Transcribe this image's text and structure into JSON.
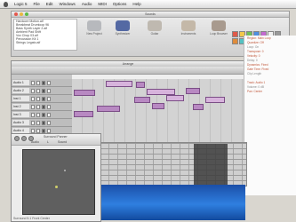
{
  "menubar": {
    "items": [
      "Apple",
      "Logic 5",
      "File",
      "Edit",
      "Windows",
      "Audio",
      "MIDI",
      "Options",
      "Help"
    ]
  },
  "top_window": {
    "title": "Sounds",
    "file_list": [
      "Hardcore Motion.aif",
      "Breakbeat Drumloop 96",
      "Bass Synth Layer 2.aif",
      "Ambient Pad Shift",
      "Vox Chop 03.aif",
      "Percussion Kit 1",
      "Strings Legato.aif"
    ],
    "tools": [
      {
        "label": "New Project",
        "icon": "document-stack-icon",
        "color": "#b7b9bd"
      },
      {
        "label": "Synthesizer",
        "icon": "keyboard-icon",
        "color": "#5469a3"
      },
      {
        "label": "Guitar",
        "icon": "guitar-icon",
        "color": "#bfb9b0"
      },
      {
        "label": "Instruments",
        "icon": "instruments-icon",
        "color": "#c4b8a8"
      },
      {
        "label": "Loop Browser",
        "icon": "loops-icon",
        "color": "#a89a8e"
      }
    ],
    "swatches": [
      "#e05a4a",
      "#f2c84b",
      "#6fbf5a",
      "#4f8fe0",
      "#c46ad0",
      "#f0f0f0",
      "#999999",
      "#e08c3b",
      "#55c2c2",
      "#3c3c3c",
      "#d64f7c",
      "#b3e05c"
    ]
  },
  "main_window": {
    "title": "Arrange",
    "tracks": [
      {
        "name": "Audio 1"
      },
      {
        "name": "Audio 2"
      },
      {
        "name": "Inst 1"
      },
      {
        "name": "Inst 2"
      },
      {
        "name": "Inst 3"
      },
      {
        "name": "Audio 3"
      },
      {
        "name": "Audio 4"
      },
      {
        "name": "Bus 1"
      },
      {
        "name": "Bus 2"
      }
    ]
  },
  "inspector": {
    "lines": [
      "Region: Main Loop",
      "Quantize: Off",
      "Loop: On",
      "Transpose: 0",
      "Velocity: 0",
      "Delay: 0",
      "Dynamics: Fixed",
      "Gate Time: Fixed",
      "Clip Length",
      "",
      "Track: Audio 1",
      "Volume: 0 dB",
      "Pan: Center"
    ]
  },
  "pad_window": {
    "title": "Surround Panner",
    "label_left": "Audio",
    "label_mid": "L",
    "label_right": "Sound",
    "footer": "Surround  5.1  Front  Center"
  }
}
